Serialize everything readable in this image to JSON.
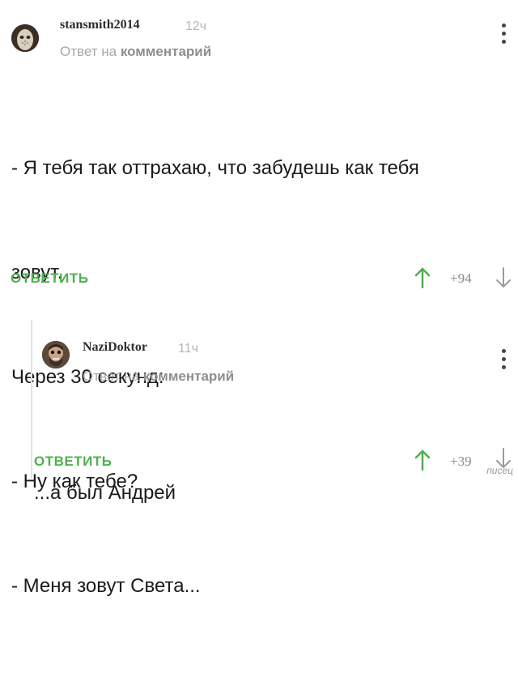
{
  "comments": [
    {
      "username": "stansmith2014",
      "time": "12ч",
      "reply_prefix": "Ответ на ",
      "reply_target": "комментарий",
      "lines": [
        "- Я тебя так оттрахаю, что забудешь как тебя",
        "зовут.",
        "Через 30 секунд:",
        "- Ну как тебе?",
        "- Меня зовут Света..."
      ],
      "reply_label": "ОТВЕТИТЬ",
      "score": "+94"
    },
    {
      "username": "NaziDoktor",
      "time": "11ч",
      "reply_prefix": "Ответ на ",
      "reply_target": "комментарий",
      "lines": [
        "...а был Андрей"
      ],
      "reply_label": "ОТВЕТИТЬ",
      "score": "+39"
    }
  ],
  "watermark": "писец",
  "colors": {
    "accent_green": "#4fb04f",
    "up_arrow": "#4fb04f",
    "down_arrow": "#9a9a9a"
  }
}
